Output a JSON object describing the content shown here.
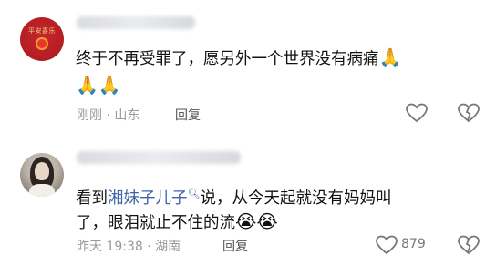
{
  "comment1": {
    "text_line1": "终于不再受罪了，愿另外一个世界没有病痛",
    "emoji_line1": "🙏",
    "emoji_line2": "🙏🙏",
    "time": "刚刚",
    "dot": "·",
    "location": "山东",
    "reply_label": "回复",
    "icons": {
      "like": "heart-icon",
      "dislike": "broken-heart-icon"
    }
  },
  "comment2": {
    "text_prefix": "看到",
    "mention": "湘妹子儿子",
    "mention_icon": "search-icon",
    "text_after_mention": "说，从今天起就没有妈妈叫",
    "text_line2": "了，眼泪就止不住的流",
    "emoji": "😭😭",
    "time": "昨天 19:38",
    "dot": "·",
    "location": "湖南",
    "reply_label": "回复",
    "likes": "879",
    "icons": {
      "like": "heart-icon",
      "dislike": "broken-heart-icon"
    }
  },
  "colors": {
    "accent_link": "#3f63a8",
    "meta_gray": "#9a9a9a"
  }
}
